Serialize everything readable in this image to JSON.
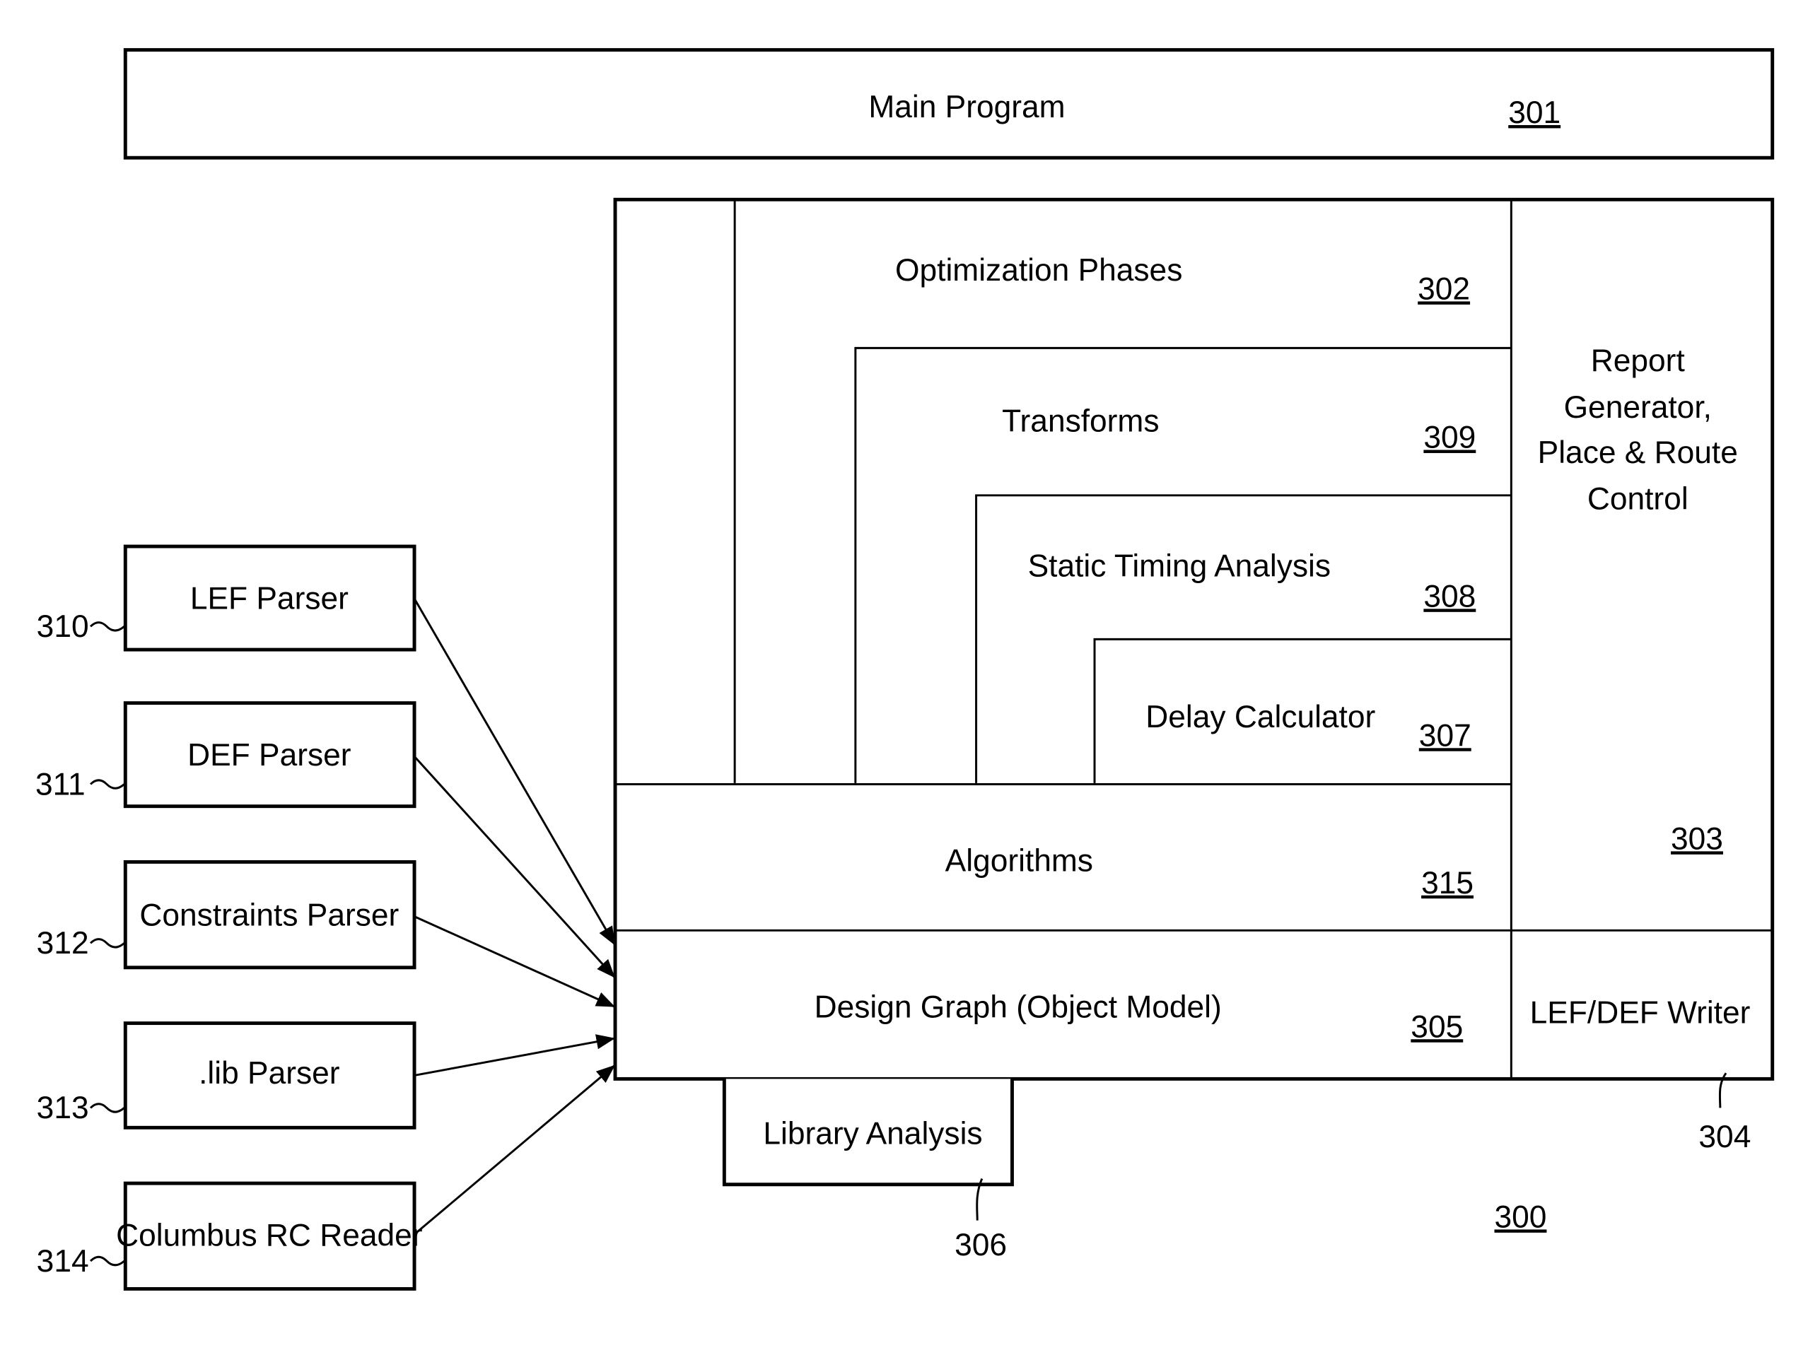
{
  "diagram": {
    "figure_number": "300",
    "main_program": {
      "label": "Main Program",
      "ref": "301"
    },
    "optimization_phases": {
      "label": "Optimization Phases",
      "ref": "302"
    },
    "transforms": {
      "label": "Transforms",
      "ref": "309"
    },
    "static_timing": {
      "label": "Static Timing Analysis",
      "ref": "308"
    },
    "delay_calculator": {
      "label": "Delay Calculator",
      "ref": "307"
    },
    "algorithms": {
      "label": "Algorithms",
      "ref": "315"
    },
    "design_graph": {
      "label": "Design Graph (Object Model)",
      "ref": "305"
    },
    "report_generator": {
      "lines": [
        "Report",
        "Generator,",
        "Place & Route",
        "Control"
      ],
      "ref": "303"
    },
    "lef_def_writer": {
      "label": "LEF/DEF Writer",
      "ref": "304"
    },
    "library_analysis": {
      "label": "Library Analysis",
      "ref": "306"
    },
    "parsers": [
      {
        "label": "LEF Parser",
        "ref": "310"
      },
      {
        "label": "DEF Parser",
        "ref": "311"
      },
      {
        "label": "Constraints Parser",
        "ref": "312"
      },
      {
        "label": ".lib Parser",
        "ref": "313"
      },
      {
        "label": "Columbus RC Reader",
        "ref": "314"
      }
    ]
  }
}
